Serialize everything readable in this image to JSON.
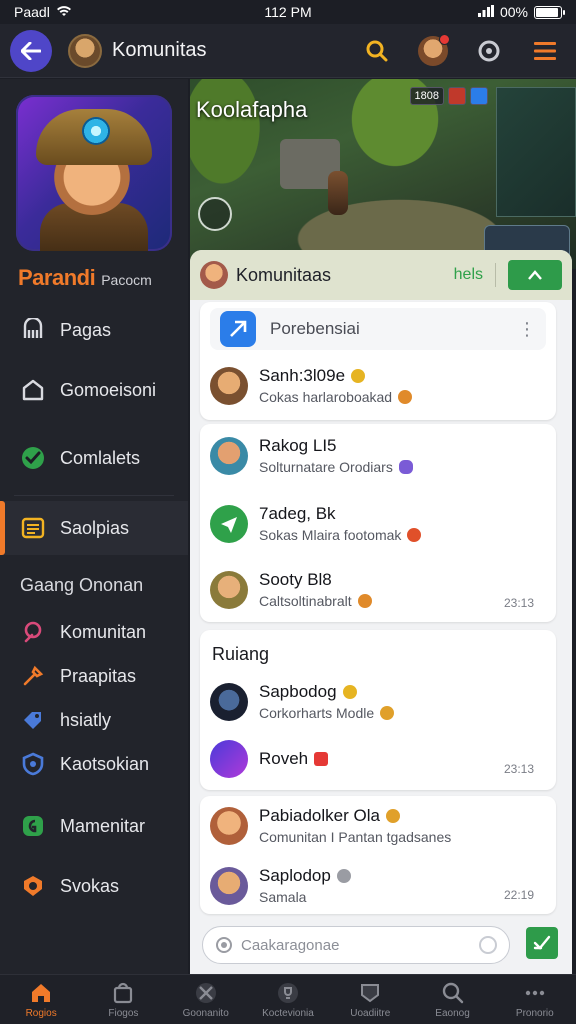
{
  "status_bar": {
    "carrier": "Paadl",
    "time": "112 PM",
    "battery": "00%"
  },
  "header": {
    "title": "Komunitas"
  },
  "sidebar": {
    "brand_name": "Parandi",
    "brand_sub": "Pacocm",
    "items": [
      {
        "label": "Pagas",
        "icon": "library-icon"
      },
      {
        "label": "Gomoeisoni",
        "icon": "home-icon"
      },
      {
        "label": "Comlalets",
        "icon": "check-circle-icon"
      },
      {
        "label": "Saolpias",
        "icon": "list-icon",
        "active": true
      }
    ],
    "section_label": "Gaang Ononan",
    "section_items": [
      {
        "label": "Komunitan",
        "icon": "link-icon",
        "color": "#d94a7a"
      },
      {
        "label": "Praapitas",
        "icon": "tools-icon",
        "color": "#f07a2a"
      },
      {
        "label": "hsiatly",
        "icon": "tag-icon",
        "color": "#4a7ad9"
      },
      {
        "label": "Kaotsokian",
        "icon": "shield-icon",
        "color": "#4a7ad9"
      },
      {
        "label": "Mamenitar",
        "icon": "chart-icon",
        "color": "#2fa14a"
      },
      {
        "label": "Svokas",
        "icon": "flame-icon",
        "color": "#f07a2a"
      }
    ]
  },
  "game": {
    "title": "Koolafapha",
    "hud": [
      "1808",
      "",
      ""
    ]
  },
  "panel": {
    "title": "Komunitaas",
    "help": "hels",
    "pinned": "Porebensiai",
    "group1": [
      {
        "name": "Sanh:3l09e",
        "sub": "Cokas harlaroboakad",
        "badge_color": "#e6b422",
        "sub_badge": "#e08a2a",
        "avatar": "#7a5030"
      }
    ],
    "group2": [
      {
        "name": "Rakog LI5",
        "sub": "Solturnatare Orodiars",
        "sub_badge": "#7a5bd6",
        "avatar": "#3a8aa6"
      },
      {
        "name": "7adeg, Bk",
        "sub": "Sokas Mlaira footomak",
        "sub_badge": "#e0502a",
        "avatar": "#2fa14a"
      },
      {
        "name": "Sooty Bl8",
        "sub": "Caltsoltinabralt",
        "sub_badge": "#e08a2a",
        "avatar": "#8a7a3a",
        "time": "23:13"
      }
    ],
    "section": "Ruiang",
    "group3": [
      {
        "name": "Sapbodog",
        "sub": "Corkorharts Modle",
        "badge_color": "#e6b422",
        "sub_badge": "#e0a02a",
        "avatar": "#2a3a5a"
      },
      {
        "name": "Roveh",
        "badge_color": "#e53935",
        "avatar": "#7a3ad9",
        "time": "23:13"
      }
    ],
    "group4": [
      {
        "name": "Pabiadolker Ola",
        "sub": "Comunitan I Pantan tgadsanes",
        "badge_color": "#e0a02a",
        "avatar": "#b0603a"
      },
      {
        "name": "Saplodop",
        "sub": "Samala",
        "badge_color": "#9a9ca3",
        "avatar": "#6a5a9a",
        "time": "22:19"
      }
    ],
    "search_placeholder": "Caakaragonae"
  },
  "tabs": [
    {
      "label": "Rogios",
      "active": true,
      "icon": "home-icon"
    },
    {
      "label": "Fiogos",
      "icon": "bag-icon"
    },
    {
      "label": "Goonanito",
      "icon": "crossed-swords-icon"
    },
    {
      "label": "Koctevionia",
      "icon": "trophy-icon"
    },
    {
      "label": "Uoadiitre",
      "icon": "ribbon-icon"
    },
    {
      "label": "Eaonog",
      "icon": "search-icon"
    },
    {
      "label": "Pronorio",
      "icon": "more-icon"
    }
  ],
  "colors": {
    "accent": "#f07a2a",
    "primary": "#4f46c8",
    "success": "#2e9b4a"
  }
}
